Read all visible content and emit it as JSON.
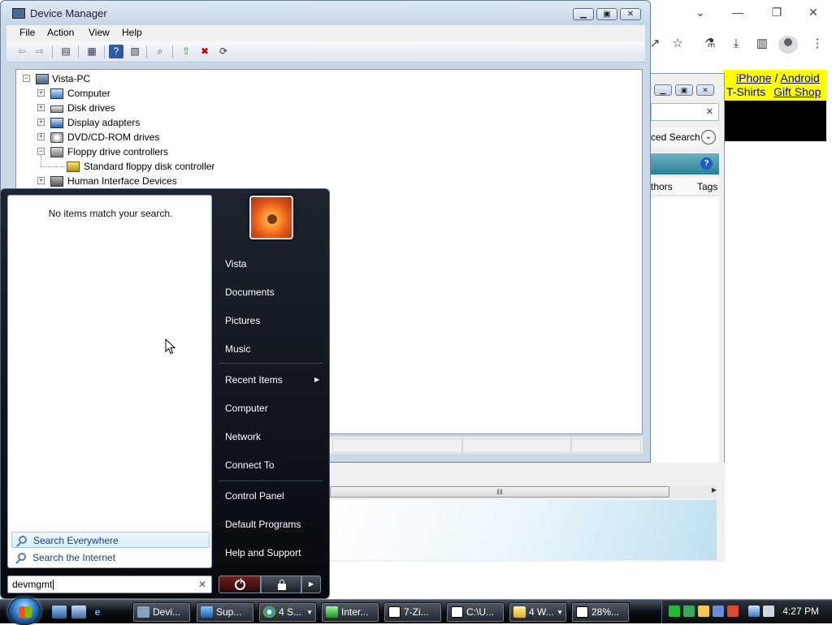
{
  "device_manager": {
    "title": "Device Manager",
    "menu": [
      "File",
      "Action",
      "View",
      "Help"
    ],
    "tree": [
      {
        "label": "Vista-PC",
        "level": 0,
        "expander": "−"
      },
      {
        "label": "Computer",
        "level": 1,
        "expander": "+"
      },
      {
        "label": "Disk drives",
        "level": 1,
        "expander": "+"
      },
      {
        "label": "Display adapters",
        "level": 1,
        "expander": "+"
      },
      {
        "label": "DVD/CD-ROM drives",
        "level": 1,
        "expander": "+"
      },
      {
        "label": "Floppy drive controllers",
        "level": 1,
        "expander": "−"
      },
      {
        "label": "Standard floppy disk controller",
        "level": 2,
        "expander": ""
      },
      {
        "label": "Human Interface Devices",
        "level": 1,
        "expander": "+"
      }
    ]
  },
  "ie_window": {
    "advanced_search": "ced Search",
    "col_authors": "thors",
    "col_tags": "Tags"
  },
  "chrome": {
    "links": {
      "iphone": "iPhone",
      "sep": "/",
      "android": "Android",
      "tshirts": "T-Shirts",
      "gift": "Gift Shop"
    }
  },
  "start_menu": {
    "no_items": "No items match your search.",
    "search_everywhere": "Search Everywhere",
    "search_internet": "Search the Internet",
    "search_value": "devmgmt",
    "right_items": {
      "vista": "Vista",
      "documents": "Documents",
      "pictures": "Pictures",
      "music": "Music",
      "recent": "Recent Items",
      "computer": "Computer",
      "network": "Network",
      "connect": "Connect To",
      "control_panel": "Control Panel",
      "default_programs": "Default Programs",
      "help": "Help and Support"
    }
  },
  "taskbar": {
    "buttons": [
      "Devi...",
      "Sup...",
      "4 S...",
      "Inter...",
      "7-Zi...",
      "C:\\U...",
      "4 W...",
      "28%..."
    ],
    "clock": "4:27 PM"
  },
  "colors": {
    "taskbar": "#0c0f14",
    "start_menu": "#07090d",
    "link_highlight": "#ffff00"
  }
}
